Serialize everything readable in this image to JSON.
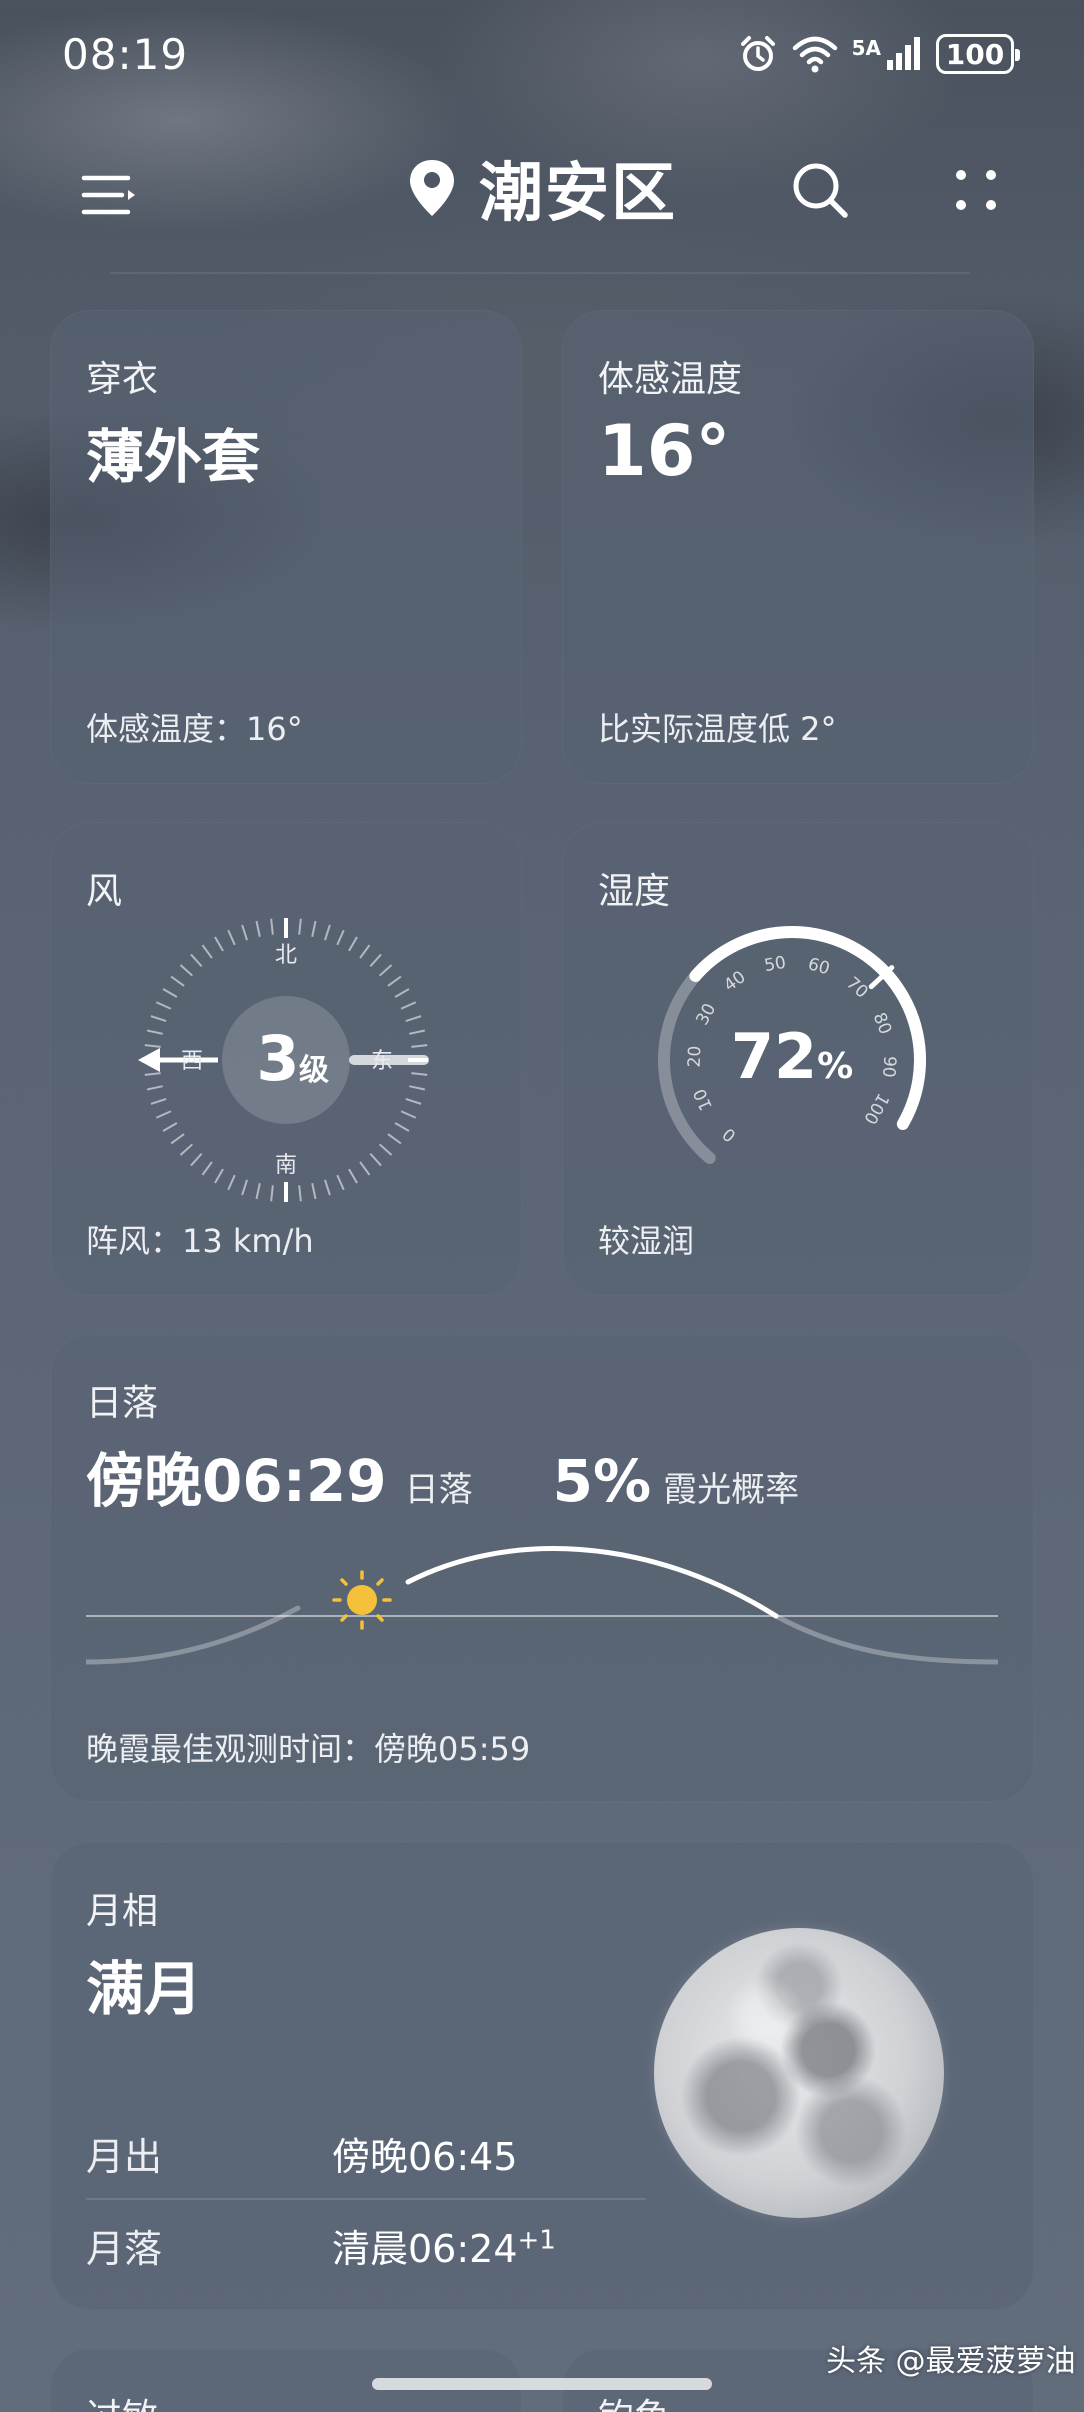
{
  "status_bar": {
    "time": "08:19",
    "network": "5A",
    "battery": "100"
  },
  "header": {
    "city": "潮安区"
  },
  "clothing": {
    "title": "穿衣",
    "value": "薄外套",
    "footer": "体感温度：16°"
  },
  "feels_like": {
    "title": "体感温度",
    "value": "16°",
    "footer": "比实际温度低 2°"
  },
  "wind": {
    "title": "风",
    "level_number": "3",
    "level_unit": "级",
    "north": "北",
    "south": "南",
    "east": "东",
    "west": "西",
    "footer": "阵风：13 km/h"
  },
  "humidity": {
    "title": "湿度",
    "value": "72",
    "unit": "%",
    "scale": [
      "0",
      "10",
      "20",
      "30",
      "40",
      "50",
      "60",
      "70",
      "80",
      "90",
      "100"
    ],
    "level": 72,
    "footer": "较湿润"
  },
  "sunset": {
    "title": "日落",
    "time": "傍晚06:29",
    "time_label": "日落",
    "glow_pct": "5%",
    "glow_label": "霞光概率",
    "footer": "晚霞最佳观测时间：傍晚05:59"
  },
  "moon": {
    "title": "月相",
    "phase": "满月",
    "rise_label": "月出",
    "rise_value": "傍晚06:45",
    "set_label": "月落",
    "set_value": "清晨06:24",
    "set_sup": "+1"
  },
  "bottom_cards": {
    "allergy_title": "过敏",
    "fishing_title": "钓鱼"
  },
  "watermark": "头条 @最爱菠萝油",
  "colors": {
    "sun": "#f5c03a",
    "card_bg": "#586272"
  }
}
